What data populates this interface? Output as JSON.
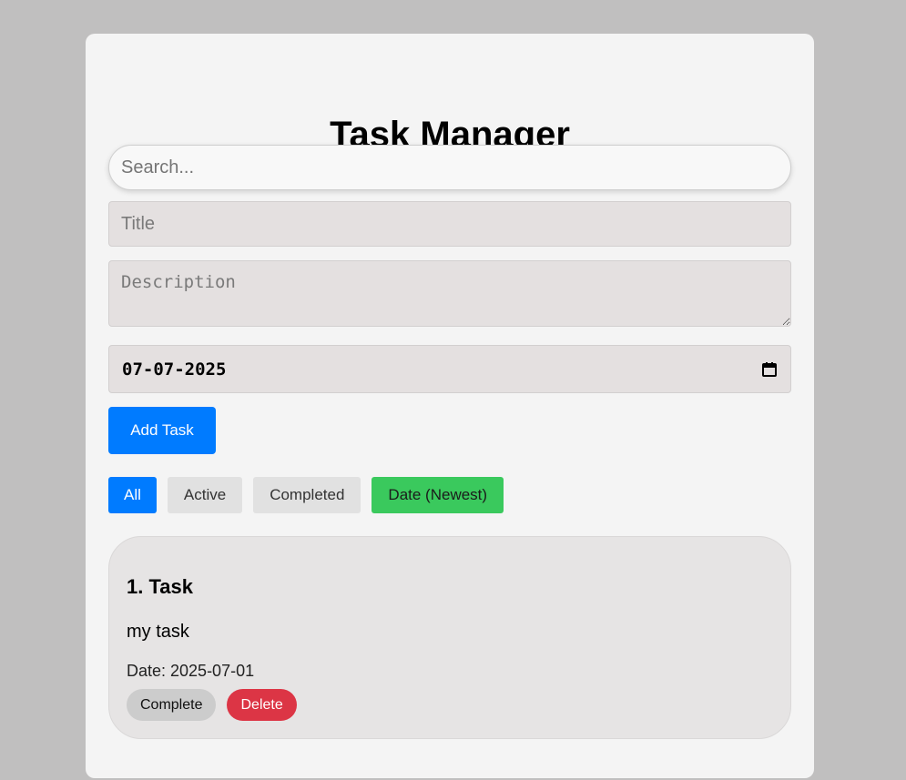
{
  "app": {
    "title": "Task Manager"
  },
  "search": {
    "placeholder": "Search..."
  },
  "form": {
    "title_placeholder": "Title",
    "description_placeholder": "Description",
    "date_value": "07-07-2025",
    "add_button_label": "Add Task"
  },
  "filters": [
    {
      "label": "All",
      "active": true
    },
    {
      "label": "Active"
    },
    {
      "label": "Completed"
    },
    {
      "label": "Date (Newest)"
    }
  ],
  "tasks": [
    {
      "title": "1. Task",
      "description": "my task",
      "date_label": "Date: 2025-07-01",
      "complete_label": "Complete",
      "delete_label": "Delete"
    }
  ],
  "colors": {
    "primary": "#007bff",
    "sort_button": "#3ac95d",
    "delete": "#dc3545",
    "page_background": "#c0bfbf",
    "card_background": "#f4f4f4"
  }
}
